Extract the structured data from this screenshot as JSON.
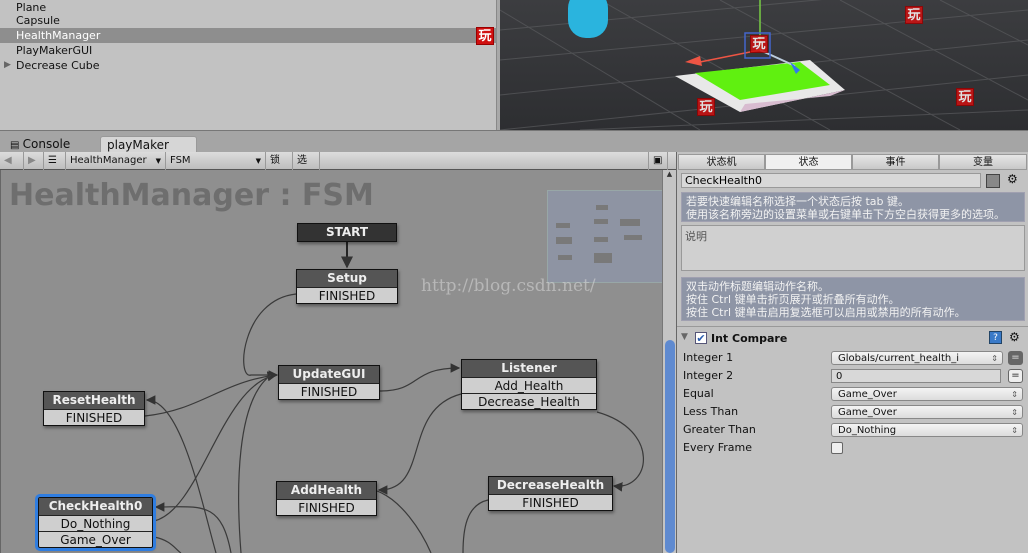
{
  "hierarchy": {
    "items": [
      {
        "label": "Plane"
      },
      {
        "label": "Capsule"
      },
      {
        "label": "HealthManager",
        "selected": true
      },
      {
        "label": "PlayMakerGUI"
      },
      {
        "label": "Decrease Cube",
        "expandable": true
      }
    ],
    "badge": "玩"
  },
  "scene": {
    "gizmo_badge": "玩"
  },
  "tabs": [
    {
      "label": "Console",
      "icon": "console-icon"
    },
    {
      "label": "playMaker",
      "active": true
    }
  ],
  "toolbar": {
    "gameobject": "HealthManager",
    "fsm": "FSM",
    "lock": "锁定",
    "select": "选择"
  },
  "graph": {
    "title": "HealthManager : FSM",
    "watermark": "http://blog.csdn.net/",
    "nodes": [
      {
        "id": "start",
        "title": "START",
        "rows": []
      },
      {
        "id": "setup",
        "title": "Setup",
        "rows": [
          "FINISHED"
        ]
      },
      {
        "id": "updategui",
        "title": "UpdateGUI",
        "rows": [
          "FINISHED"
        ]
      },
      {
        "id": "listener",
        "title": "Listener",
        "rows": [
          "Add_Health",
          "Decrease_Health"
        ]
      },
      {
        "id": "resethealth",
        "title": "ResetHealth",
        "rows": [
          "FINISHED"
        ]
      },
      {
        "id": "addhealth",
        "title": "AddHealth",
        "rows": [
          "FINISHED"
        ]
      },
      {
        "id": "decreasehealth",
        "title": "DecreaseHealth",
        "rows": [
          "FINISHED"
        ]
      },
      {
        "id": "checkhealth0",
        "title": "CheckHealth0",
        "rows": [
          "Do_Nothing",
          "Game_Over"
        ],
        "selected": true
      }
    ]
  },
  "inspector": {
    "tabs": [
      "状态机",
      "状态",
      "事件",
      "变量"
    ],
    "active_tab": 1,
    "state_name": "CheckHealth0",
    "hint1": [
      "若要快速编辑名称选择一个状态后按 tab 键。",
      "使用该名称旁边的设置菜单或右键单击下方空白获得更多的选项。"
    ],
    "description_placeholder": "说明",
    "hint2": [
      "双击动作标题编辑动作名称。",
      "按住 Ctrl 键单击折页展开或折叠所有动作。",
      "按住 Ctrl 键单击启用复选框可以启用或禁用的所有动作。"
    ],
    "action": {
      "title": "Int Compare",
      "enabled": true,
      "fields": [
        {
          "label": "Integer 1",
          "value": "Globals/current_health_i",
          "type": "select"
        },
        {
          "label": "Integer 2",
          "value": "0",
          "type": "input"
        },
        {
          "label": "Equal",
          "value": "Game_Over",
          "type": "select"
        },
        {
          "label": "Less Than",
          "value": "Game_Over",
          "type": "select"
        },
        {
          "label": "Greater Than",
          "value": "Do_Nothing",
          "type": "select"
        },
        {
          "label": "Every Frame",
          "checked": false,
          "type": "checkbox"
        }
      ]
    }
  },
  "colors": {
    "selection": "#2f7de0",
    "badge": "#d01010"
  }
}
